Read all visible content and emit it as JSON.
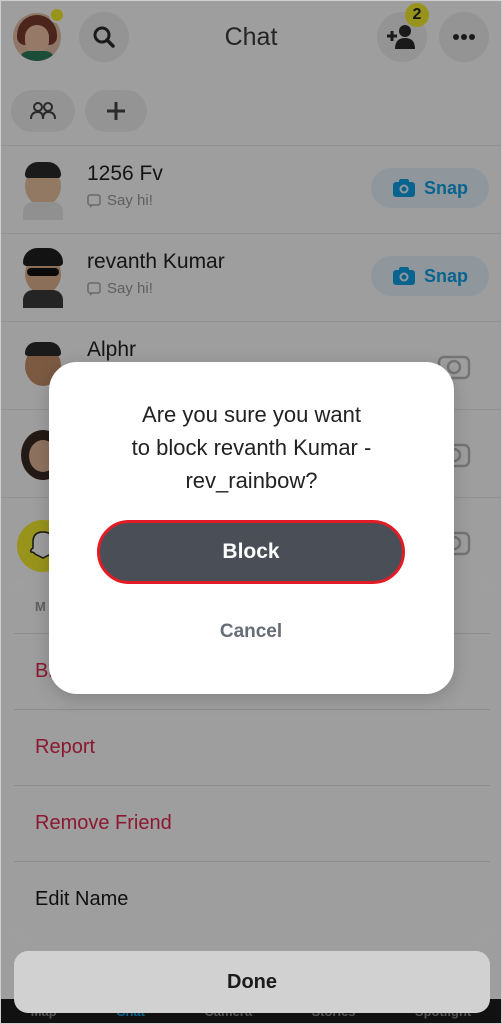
{
  "header": {
    "title": "Chat",
    "friend_request_count": "2"
  },
  "chats": [
    {
      "name": "1256 Fv",
      "status": "Say hi!",
      "action": "Snap"
    },
    {
      "name": "revanth Kumar",
      "status": "Say hi!",
      "action": "Snap"
    },
    {
      "name": "Alphr"
    }
  ],
  "sheet": {
    "header": "M",
    "items": [
      {
        "label": "Bl"
      },
      {
        "label": "Report"
      },
      {
        "label": "Remove Friend"
      },
      {
        "label": "Edit Name"
      }
    ],
    "done_label": "Done"
  },
  "bottom_nav": [
    "Map",
    "Chat",
    "Camera",
    "Stories",
    "Spotlight"
  ],
  "dialog": {
    "line1": "Are you sure you want",
    "line2": "to block revanth Kumar -",
    "line3": "rev_rainbow?",
    "block_label": "Block",
    "cancel_label": "Cancel"
  },
  "colors": {
    "snap_blue": "#0ea1e6",
    "destructive_red": "#e0274f",
    "block_button_bg": "#4a4f57",
    "highlight_outline": "#e31b24",
    "badge_yellow": "#f5ef2c"
  }
}
